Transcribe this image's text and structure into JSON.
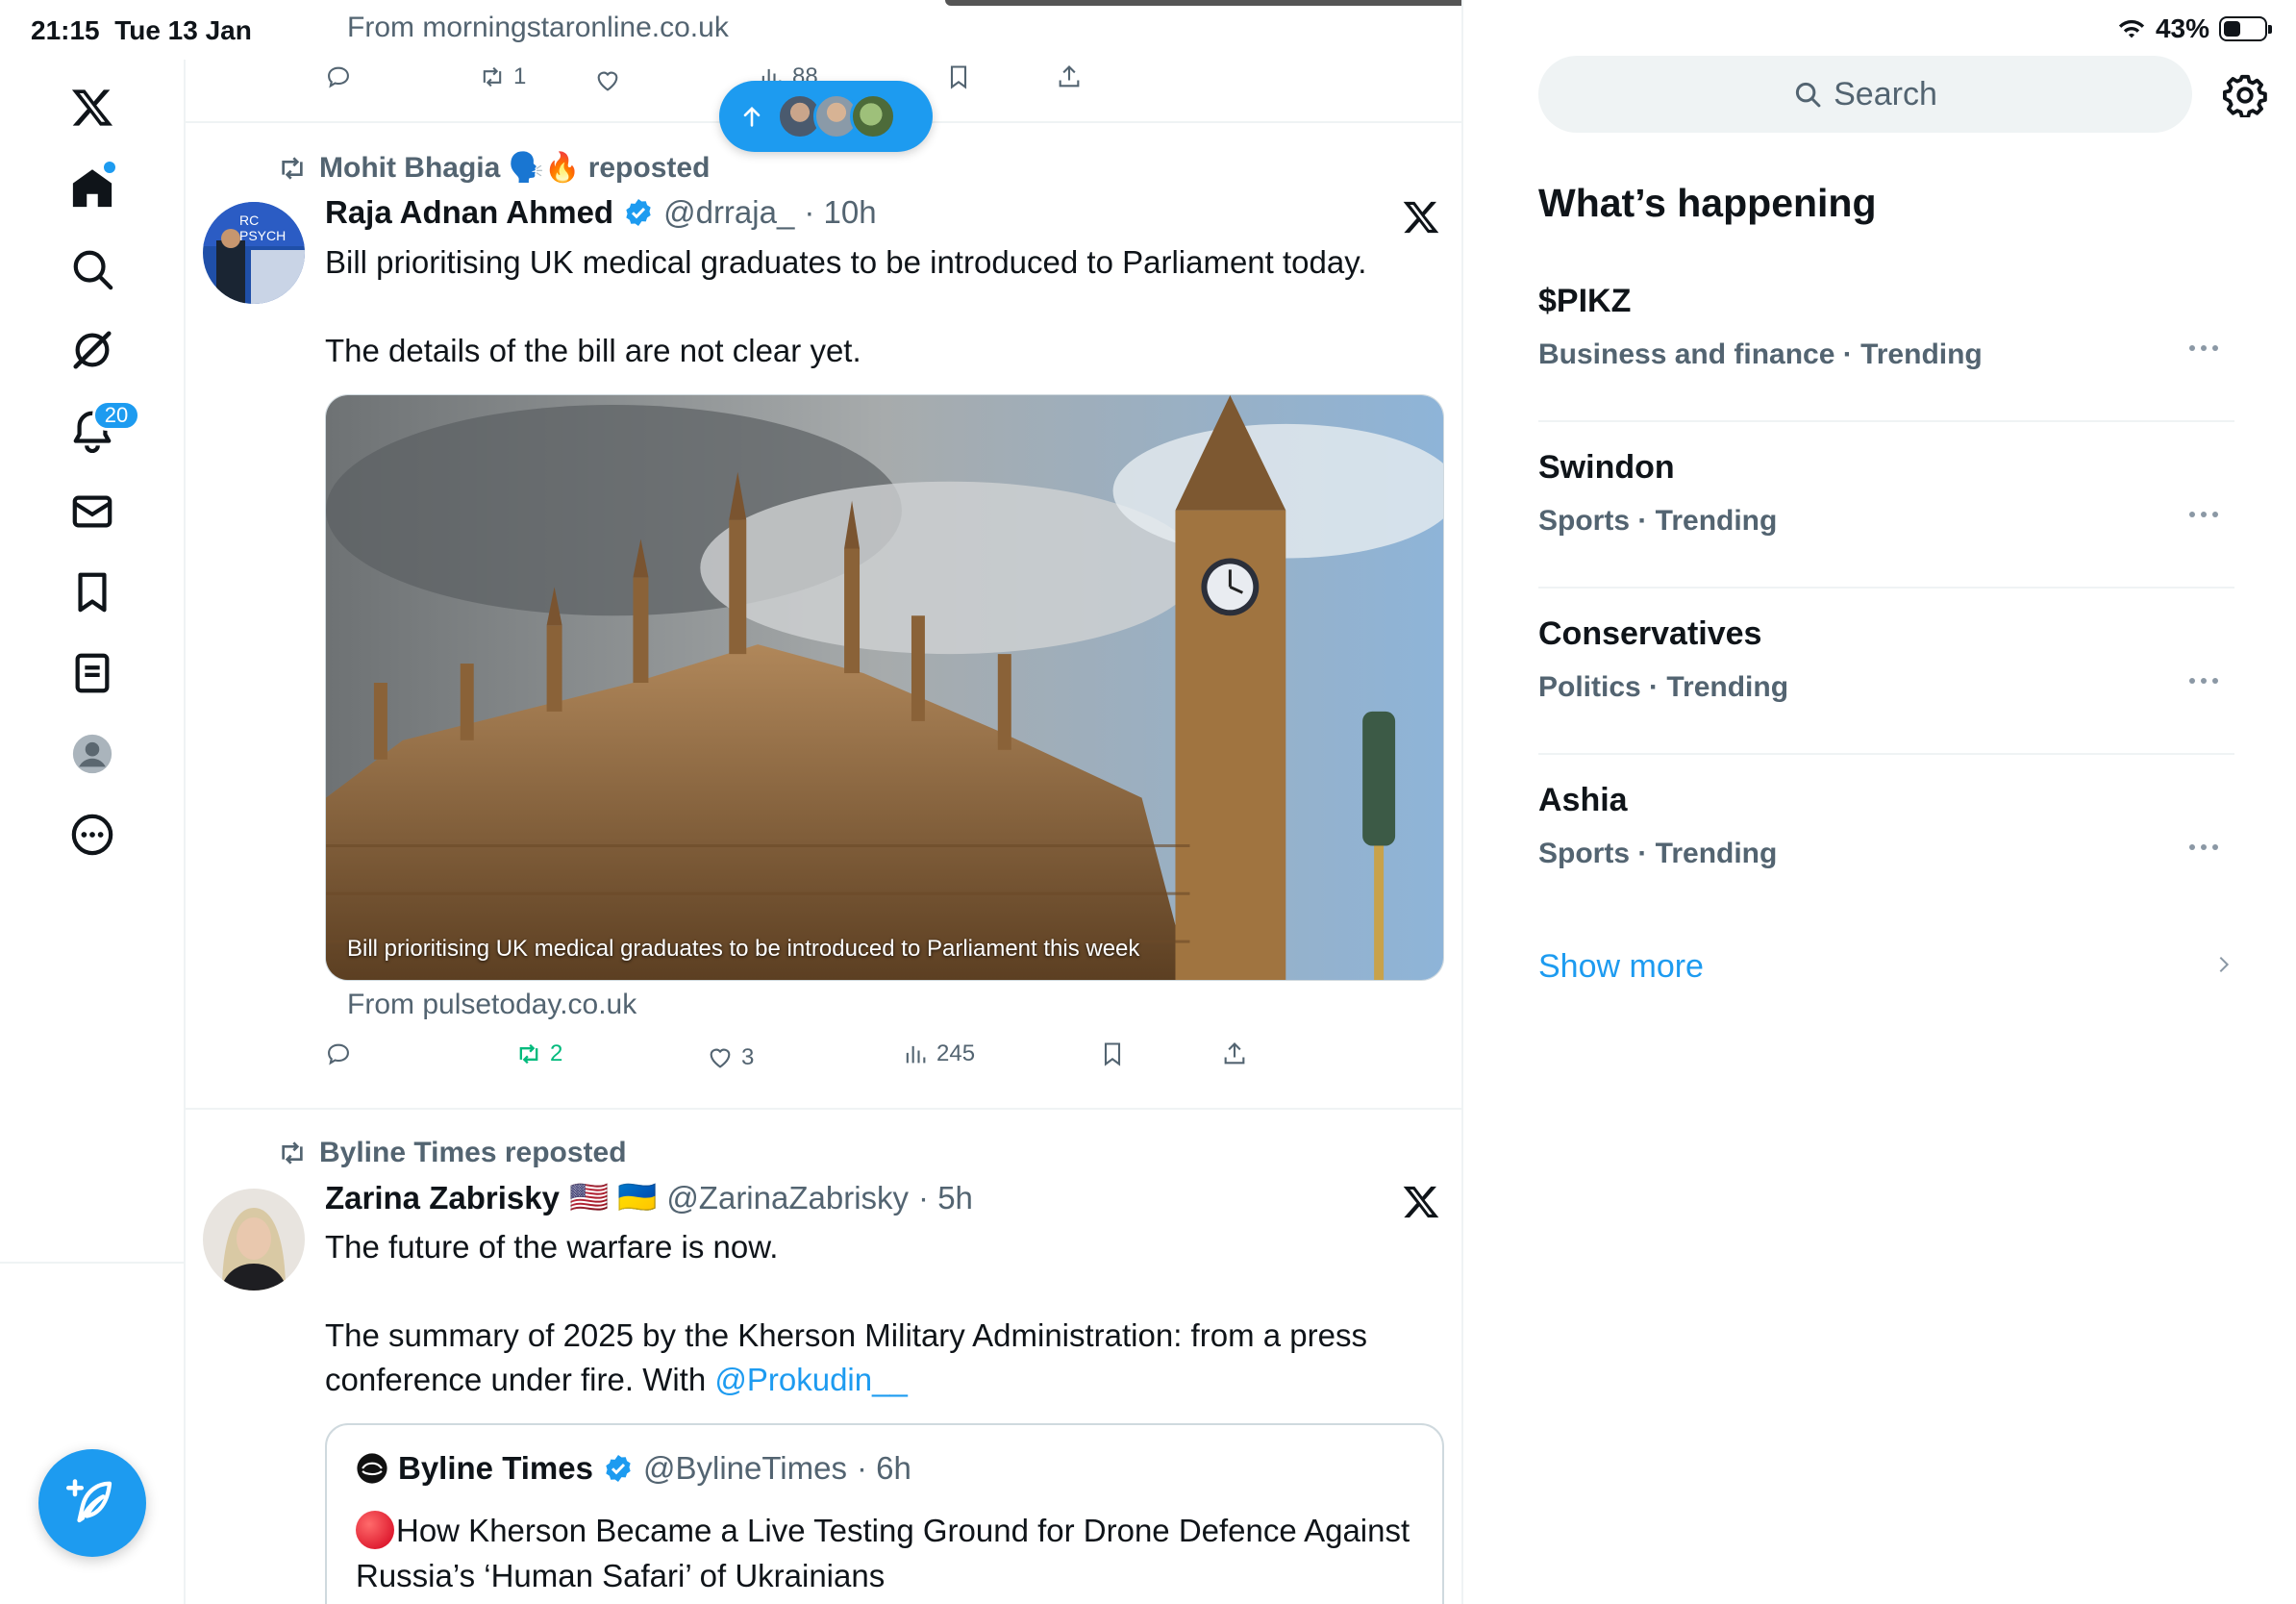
{
  "status_bar": {
    "time": "21:15",
    "date": "Tue 13 Jan",
    "battery": "43%",
    "battery_level": 0.43
  },
  "nav": {
    "items": [
      "x-logo",
      "home",
      "explore",
      "grok",
      "notifications",
      "messages",
      "bookmarks",
      "lists",
      "profile",
      "more"
    ],
    "notifications_badge": "20",
    "compose_icon": "compose-plus-feather-icon"
  },
  "feed": {
    "top_tweet": {
      "source": "From morningstaronline.co.uk",
      "reposts": "1",
      "views": "88"
    },
    "new_posts_pill": {
      "icon": "arrow-up-icon"
    },
    "tweet1": {
      "reposted_by": "Mohit Bhagia 🗣️🔥 reposted",
      "name": "Raja Adnan Ahmed",
      "handle": "@drraja_",
      "time": "· 10h",
      "text": "Bill prioritising UK medical graduates to be introduced to Parliament today.\n\nThe details of the bill are not clear yet.",
      "media_caption": "Bill prioritising UK medical graduates to be introduced to Parliament this week",
      "source": "From pulsetoday.co.uk",
      "reposts": "2",
      "likes": "3",
      "views": "245"
    },
    "tweet2": {
      "reposted_by": "Byline Times reposted",
      "name": "Zarina Zabrisky",
      "flags": "🇺🇸 🇺🇦",
      "handle": "@ZarinaZabrisky",
      "time": "· 5h",
      "text_before": "The future of the warfare is now.\n\nThe summary of 2025 by the Kherson Military Administration: from a press conference under fire.  With ",
      "mention": "@Prokudin__",
      "quote": {
        "name": "Byline Times",
        "handle": "@BylineTimes",
        "time": "· 6h",
        "text": "How Kherson Became a Live Testing Ground for Drone Defence Against Russia’s ‘Human Safari’ of Ukrainians"
      }
    }
  },
  "sidebar": {
    "search_placeholder": "Search",
    "title": "What’s happening",
    "trends": [
      {
        "name": "$PIKZ",
        "meta": "Business and finance · Trending"
      },
      {
        "name": "Swindon",
        "meta": "Sports · Trending"
      },
      {
        "name": "Conservatives",
        "meta": "Politics · Trending"
      },
      {
        "name": "Ashia",
        "meta": "Sports · Trending"
      }
    ],
    "show_more": "Show more"
  },
  "colors": {
    "accent": "#1d9bf0",
    "text": "#0f1419",
    "muted": "#536471",
    "repost_green": "#00ba7c",
    "border": "#eff3f4"
  }
}
